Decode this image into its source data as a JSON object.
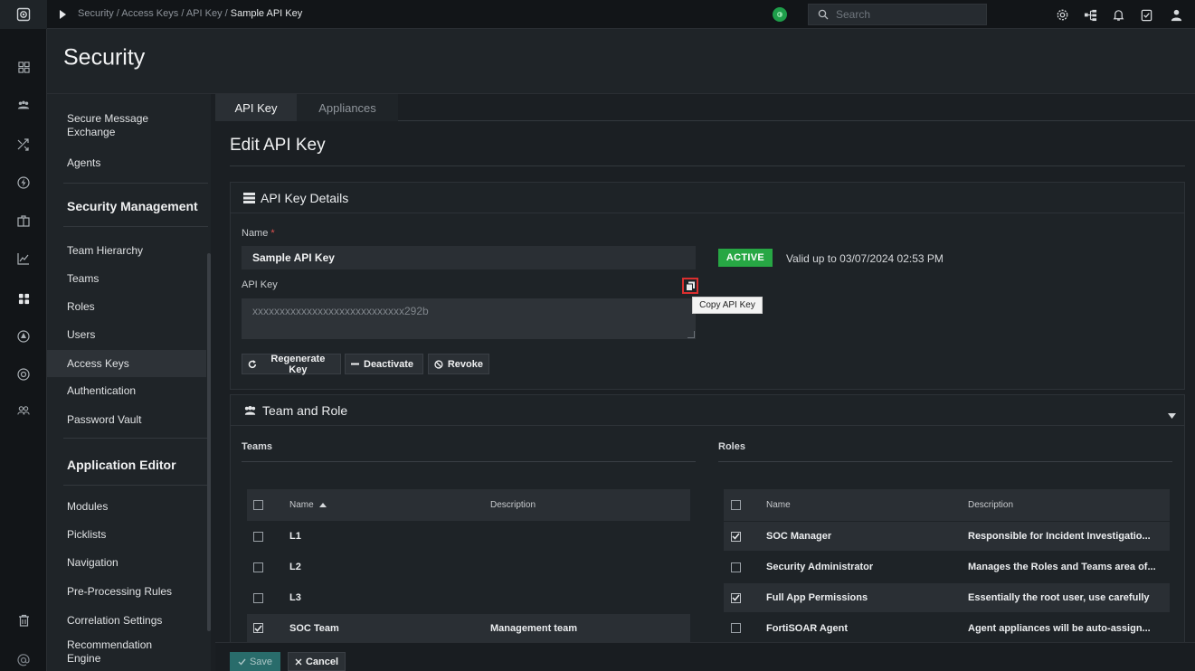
{
  "topbar": {
    "breadcrumb_path": "Security / Access Keys / API Key /",
    "breadcrumb_current": "Sample API Key",
    "search_placeholder": "Search",
    "icons": [
      "settings-icon",
      "team-tree-icon",
      "bell-icon",
      "clipboard-check-icon",
      "user-icon"
    ]
  },
  "rail": {
    "icons": [
      "dashboard-icon",
      "incidents-icon",
      "shuffle-icon",
      "bolt-icon",
      "briefcase-icon",
      "analytics-icon",
      "modules-icon",
      "threat-icon",
      "globe-icon",
      "users-icon",
      "trash-icon",
      "at-icon"
    ]
  },
  "page": {
    "title": "Security"
  },
  "sidebar": {
    "items_top": [
      {
        "label": "Secure Message Exchange"
      },
      {
        "label": "Agents"
      }
    ],
    "group_security_management": "Security Management",
    "items_mgmt": [
      {
        "label": "Team Hierarchy"
      },
      {
        "label": "Teams"
      },
      {
        "label": "Roles"
      },
      {
        "label": "Users"
      },
      {
        "label": "Access Keys",
        "active": true
      },
      {
        "label": "Authentication"
      },
      {
        "label": "Password Vault"
      }
    ],
    "group_application_editor": "Application Editor",
    "items_app": [
      {
        "label": "Modules"
      },
      {
        "label": "Picklists"
      },
      {
        "label": "Navigation"
      },
      {
        "label": "Pre-Processing Rules"
      },
      {
        "label": "Correlation Settings"
      },
      {
        "label": "Recommendation Engine"
      }
    ]
  },
  "tabs": [
    {
      "label": "API Key",
      "active": true
    },
    {
      "label": "Appliances",
      "active": false
    }
  ],
  "edit": {
    "title": "Edit API Key",
    "details_header": "API Key Details",
    "name_label": "Name",
    "required_mark": "*",
    "name_value": "Sample API Key",
    "apikey_label": "API Key",
    "apikey_value": "xxxxxxxxxxxxxxxxxxxxxxxxxxxx292b",
    "copy_tooltip": "Copy API Key",
    "status_badge": "ACTIVE",
    "valid_text": "Valid up to 03/07/2024 02:53 PM",
    "buttons": {
      "regenerate": "Regenerate Key",
      "deactivate": "Deactivate",
      "revoke": "Revoke"
    }
  },
  "team_role": {
    "header": "Team and Role",
    "teams_label": "Teams",
    "roles_label": "Roles",
    "teams_columns": {
      "name": "Name",
      "description": "Description"
    },
    "roles_columns": {
      "name": "Name",
      "description": "Description"
    },
    "teams_rows": [
      {
        "name": "L1",
        "description": "",
        "checked": false
      },
      {
        "name": "L2",
        "description": "",
        "checked": false
      },
      {
        "name": "L3",
        "description": "",
        "checked": false
      },
      {
        "name": "SOC Team",
        "description": "Management team",
        "checked": true
      }
    ],
    "roles_rows": [
      {
        "name": "SOC Manager",
        "description": "Responsible for Incident Investigatio...",
        "checked": true
      },
      {
        "name": "Security Administrator",
        "description": "Manages the Roles and Teams area of...",
        "checked": false
      },
      {
        "name": "Full App Permissions",
        "description": "Essentially the root user, use carefully",
        "checked": true
      },
      {
        "name": "FortiSOAR Agent",
        "description": "Agent appliances will be auto-assign...",
        "checked": false
      }
    ]
  },
  "footer": {
    "save": "Save",
    "cancel": "Cancel"
  },
  "colors": {
    "active_badge": "#27a744",
    "save_button": "#2c7a79",
    "highlight_border": "#d92f2f"
  }
}
